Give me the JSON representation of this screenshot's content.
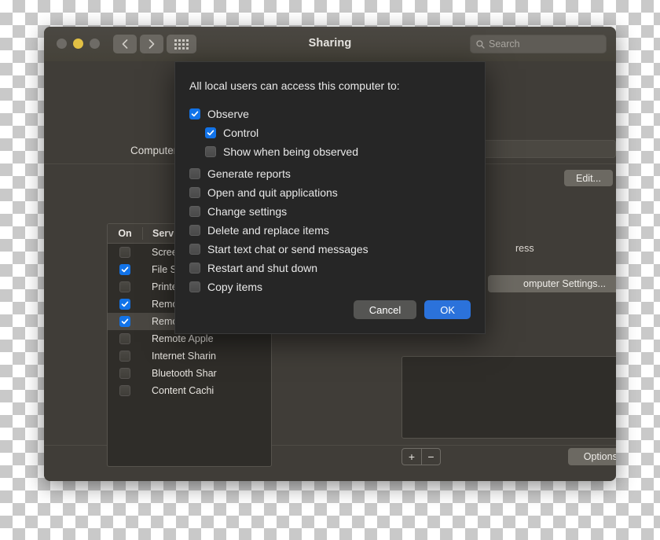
{
  "window": {
    "title": "Sharing",
    "traffic_lights": [
      "close-button",
      "minimize-button",
      "zoom-button"
    ],
    "nav": {
      "back": "back-button",
      "forward": "forward-button",
      "grid": "show-all-button"
    },
    "search": {
      "placeholder": "Search",
      "value": ""
    }
  },
  "main": {
    "computer_name_label": "Computer Name:",
    "computer_name_value": "",
    "edit_button": "Edit...",
    "service_table": {
      "headers": {
        "on": "On",
        "service": "Service"
      },
      "rows": [
        {
          "name": "Screen Sharing",
          "checked": false,
          "selected": false
        },
        {
          "name": "File Sharing",
          "checked": true,
          "selected": false
        },
        {
          "name": "Printer Sharing",
          "checked": false,
          "selected": false
        },
        {
          "name": "Remote Login",
          "checked": true,
          "selected": false
        },
        {
          "name": "Remote Manag",
          "checked": true,
          "selected": true
        },
        {
          "name": "Remote Apple",
          "checked": false,
          "selected": false
        },
        {
          "name": "Internet Sharin",
          "checked": false,
          "selected": false
        },
        {
          "name": "Bluetooth Shar",
          "checked": false,
          "selected": false
        },
        {
          "name": "Content Cachi",
          "checked": false,
          "selected": false
        }
      ]
    },
    "address_text": "ress",
    "computer_settings_button": "omputer Settings...",
    "add_button": "+",
    "remove_button": "−",
    "options_button": "Options...",
    "help_button": "?"
  },
  "dialog": {
    "title": "All local users can access this computer to:",
    "options": [
      {
        "label": "Observe",
        "checked": true,
        "indent": 0
      },
      {
        "label": "Control",
        "checked": true,
        "indent": 1
      },
      {
        "label": "Show when being observed",
        "checked": false,
        "indent": 1
      },
      {
        "label": "Generate reports",
        "checked": false,
        "indent": 0
      },
      {
        "label": "Open and quit applications",
        "checked": false,
        "indent": 0
      },
      {
        "label": "Change settings",
        "checked": false,
        "indent": 0
      },
      {
        "label": "Delete and replace items",
        "checked": false,
        "indent": 0
      },
      {
        "label": "Start text chat or send messages",
        "checked": false,
        "indent": 0
      },
      {
        "label": "Restart and shut down",
        "checked": false,
        "indent": 0
      },
      {
        "label": "Copy items",
        "checked": false,
        "indent": 0
      }
    ],
    "cancel_button": "Cancel",
    "ok_button": "OK"
  },
  "colors": {
    "accent_blue": "#1273e8",
    "ok_button_blue": "#2b72db",
    "window_bg": "#403d38",
    "dialog_bg": "#262626",
    "minimize_yellow": "#e2c044"
  }
}
